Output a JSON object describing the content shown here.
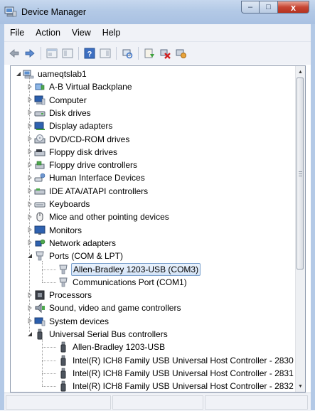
{
  "window": {
    "title": "Device Manager",
    "minimize_glyph": "–",
    "maximize_glyph": "□",
    "close_glyph": "x"
  },
  "menu": {
    "items": [
      "File",
      "Action",
      "View",
      "Help"
    ]
  },
  "toolbar": {
    "buttons": [
      "back-icon",
      "forward-icon",
      "properties-icon",
      "show-hide-console-tree-icon",
      "help-icon",
      "action-pane-icon",
      "scan-hardware-icon",
      "update-driver-icon",
      "uninstall-device-icon",
      "enable-device-icon"
    ]
  },
  "tree": {
    "root": "uameqtslab1",
    "nodes": [
      {
        "label": "A-B Virtual Backplane",
        "icon": "backplane-icon"
      },
      {
        "label": "Computer",
        "icon": "computer-icon"
      },
      {
        "label": "Disk drives",
        "icon": "disk-drive-icon"
      },
      {
        "label": "Display adapters",
        "icon": "display-adapter-icon"
      },
      {
        "label": "DVD/CD-ROM drives",
        "icon": "dvd-drive-icon"
      },
      {
        "label": "Floppy disk drives",
        "icon": "floppy-icon"
      },
      {
        "label": "Floppy drive controllers",
        "icon": "floppy-controller-icon"
      },
      {
        "label": "Human Interface Devices",
        "icon": "hid-icon"
      },
      {
        "label": "IDE ATA/ATAPI controllers",
        "icon": "ide-controller-icon"
      },
      {
        "label": "Keyboards",
        "icon": "keyboard-icon"
      },
      {
        "label": "Mice and other pointing devices",
        "icon": "mouse-icon"
      },
      {
        "label": "Monitors",
        "icon": "monitor-icon"
      },
      {
        "label": "Network adapters",
        "icon": "network-adapter-icon"
      },
      {
        "label": "Ports (COM & LPT)",
        "icon": "port-icon",
        "expanded": true,
        "children": [
          {
            "label": "Allen-Bradley 1203-USB (COM3)",
            "icon": "port-icon",
            "selected": true
          },
          {
            "label": "Communications Port (COM1)",
            "icon": "port-icon"
          }
        ]
      },
      {
        "label": "Processors",
        "icon": "processor-icon"
      },
      {
        "label": "Sound, video and game controllers",
        "icon": "sound-icon"
      },
      {
        "label": "System devices",
        "icon": "system-devices-icon"
      },
      {
        "label": "Universal Serial Bus controllers",
        "icon": "usb-icon",
        "expanded": true,
        "children": [
          {
            "label": "Allen-Bradley 1203-USB",
            "icon": "usb-icon"
          },
          {
            "label": "Intel(R) ICH8 Family USB Universal Host Controller - 2830",
            "icon": "usb-icon"
          },
          {
            "label": "Intel(R) ICH8 Family USB Universal Host Controller - 2831",
            "icon": "usb-icon"
          },
          {
            "label": "Intel(R) ICH8 Family USB Universal Host Controller - 2832",
            "icon": "usb-icon"
          }
        ]
      }
    ]
  },
  "colors": {
    "titlebar": "#b3c9e6",
    "selection": "#d4e4f7",
    "close_button": "#c74634"
  }
}
